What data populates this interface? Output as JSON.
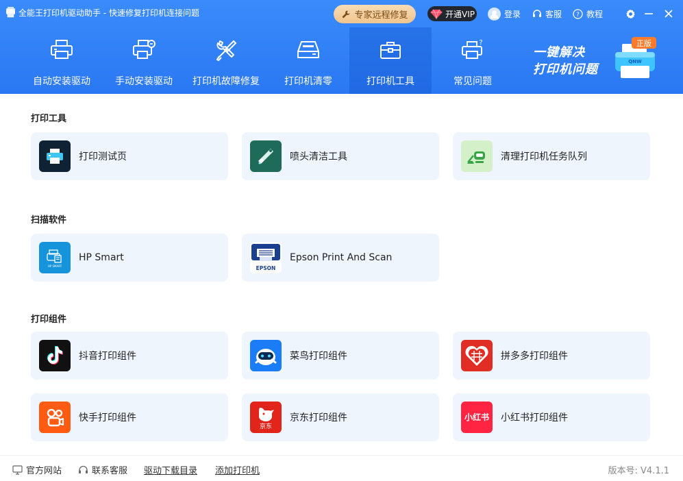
{
  "app": {
    "title": "全能王打印机驱动助手 - 快速修复打印机连接问题",
    "expert_repair": "专家远程修复",
    "vip": "开通VIP",
    "login": "登录",
    "service": "客服",
    "tutorial": "教程"
  },
  "nav": {
    "tabs": [
      {
        "label": "自动安装驱动",
        "icon": "printer-icon"
      },
      {
        "label": "手动安装驱动",
        "icon": "printer-hand-icon"
      },
      {
        "label": "打印机故障修复",
        "icon": "wrench-icon"
      },
      {
        "label": "打印机清零",
        "icon": "tray-icon"
      },
      {
        "label": "打印机工具",
        "icon": "toolbox-icon",
        "active": true
      },
      {
        "label": "常见问题",
        "icon": "printer-question-icon"
      }
    ]
  },
  "banner": {
    "line1": "一键解决",
    "line2": "打印机问题",
    "badge": "正版"
  },
  "sections": {
    "print_tools": {
      "title": "打印工具",
      "items": [
        "打印测试页",
        "喷头清洁工具",
        "清理打印机任务队列"
      ]
    },
    "scan_software": {
      "title": "扫描软件",
      "items": [
        "HP Smart",
        "Epson Print And Scan"
      ]
    },
    "print_plugins": {
      "title": "打印组件",
      "items": [
        "抖音打印组件",
        "菜鸟打印组件",
        "拼多多打印组件",
        "快手打印组件",
        "京东打印组件",
        "小红书打印组件"
      ]
    }
  },
  "icon_text": {
    "hp_small": "HP SMART",
    "epson": "EPSON",
    "jd": "京东",
    "xhs": "小红书"
  },
  "footer": {
    "official_site": "官方网站",
    "contact_service": "联系客服",
    "driver_catalog": "驱动下载目录",
    "add_printer": "添加打印机",
    "version": "版本号:  V4.1.1"
  },
  "colors": {
    "header_blue": "#2f80f6",
    "card_bg": "#eef5fd",
    "expert_gold": "#f2cc98",
    "vip_dark": "#22262e"
  }
}
